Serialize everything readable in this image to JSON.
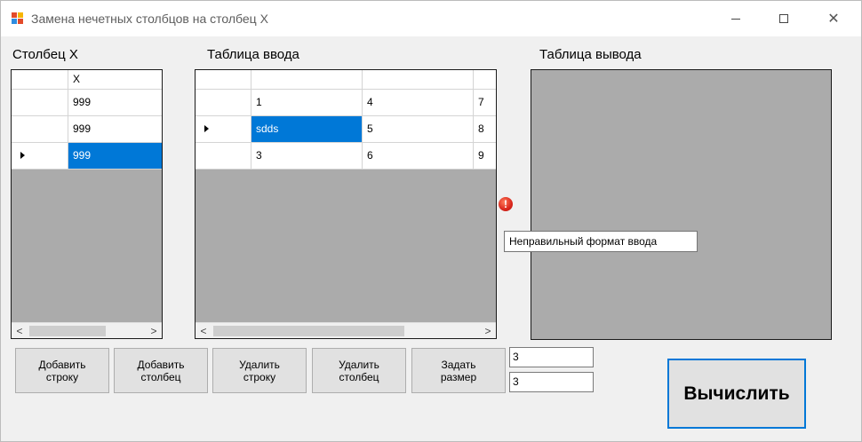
{
  "window": {
    "title": "Замена нечетных столбцов на столбец X",
    "min_glyph": "—",
    "close_glyph": "✕"
  },
  "labels": {
    "column_x": "Столбец X",
    "input_table": "Таблица ввода",
    "output_table": "Таблица вывода"
  },
  "column_x_grid": {
    "header": "X",
    "rows": [
      "999",
      "999",
      "999"
    ],
    "selected_row": 2
  },
  "input_grid": {
    "rows": [
      [
        "1",
        "4",
        "7"
      ],
      [
        "sdds",
        "5",
        "8"
      ],
      [
        "3",
        "6",
        "9"
      ]
    ],
    "selected_row": 1
  },
  "error": {
    "icon": "error-icon",
    "glyph": "!",
    "tooltip": "Неправильный формат ввода"
  },
  "buttons": {
    "add_row": "Добавить\nстроку",
    "add_column": "Добавить\nстолбец",
    "delete_row": "Удалить\nстроку",
    "delete_column": "Удалить\nстолбец",
    "set_size": "Задать\nразмер",
    "calculate": "Вычислить"
  },
  "size_inputs": {
    "rows": "3",
    "cols": "3"
  },
  "scroll": {
    "left_glyph": "<",
    "right_glyph": ">"
  },
  "colors": {
    "selection": "#0078d7",
    "grid_background": "#ababab"
  }
}
